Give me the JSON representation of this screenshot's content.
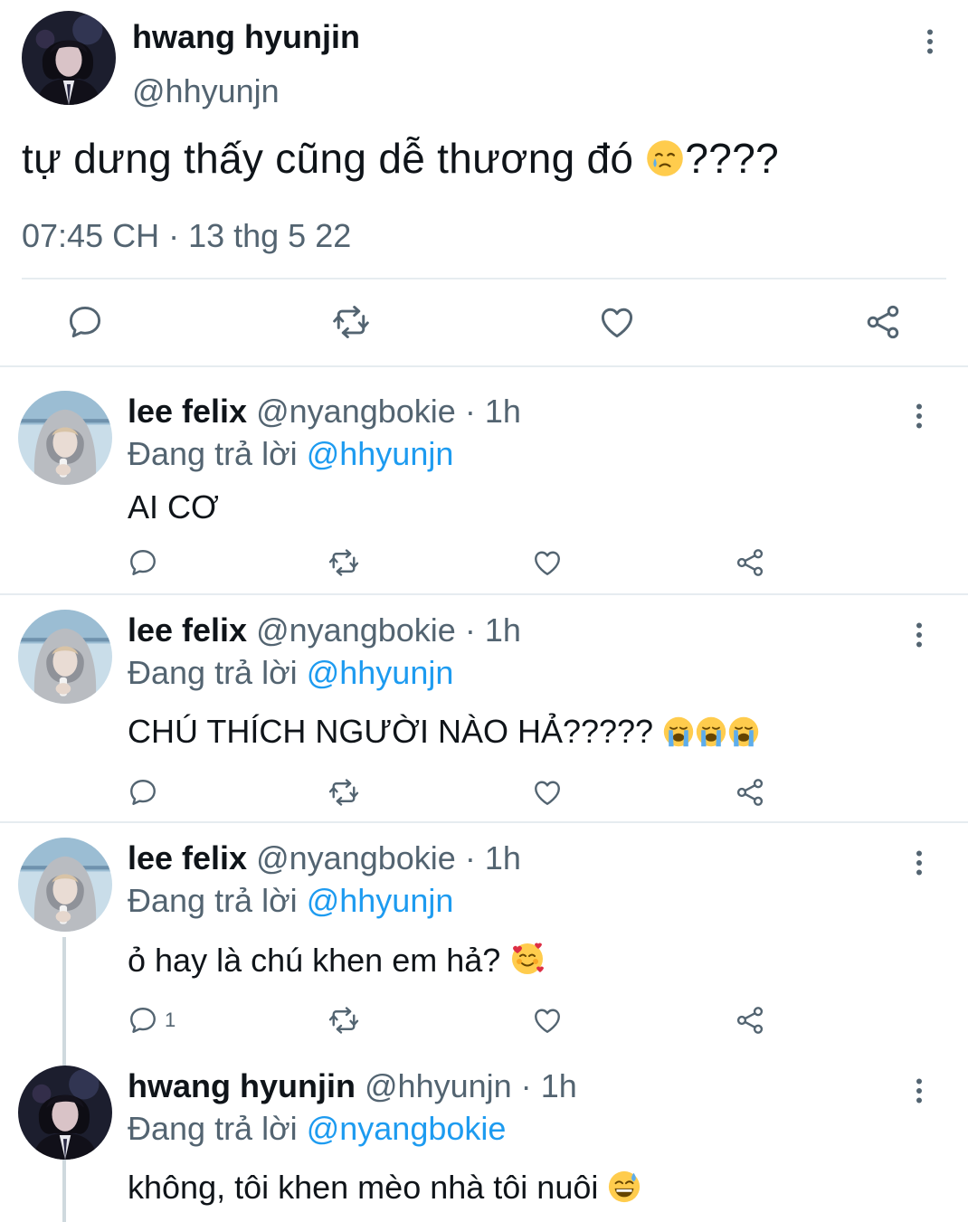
{
  "main_tweet": {
    "name": "hwang hyunjin",
    "handle": "@hhyunjn",
    "text": "tự dưng thấy cũng dễ thương đó",
    "text_suffix": "????",
    "text_emoji": "face-holding-back-tears",
    "meta": "07:45 CH · 13 thg 5 22",
    "actions": [
      "reply-icon",
      "retweet-icon",
      "like-icon",
      "share-icon"
    ]
  },
  "replies": [
    {
      "name": "lee felix",
      "handle": "@nyangbokie",
      "time": "1h",
      "replying_prefix": "Đang trả lời",
      "replying_to": "@hhyunjn",
      "text": "AI CƠ",
      "emojis": [],
      "reply_count": ""
    },
    {
      "name": "lee felix",
      "handle": "@nyangbokie",
      "time": "1h",
      "replying_prefix": "Đang trả lời",
      "replying_to": "@hhyunjn",
      "text": "CHÚ THÍCH NGƯỜI NÀO HẢ?????",
      "emojis": [
        "loudly-crying-face",
        "loudly-crying-face",
        "loudly-crying-face"
      ],
      "reply_count": ""
    },
    {
      "name": "lee felix",
      "handle": "@nyangbokie",
      "time": "1h",
      "replying_prefix": "Đang trả lời",
      "replying_to": "@hhyunjn",
      "text": "ỏ hay là chú khen em hả?",
      "emojis": [
        "smiling-face-with-hearts"
      ],
      "reply_count": "1"
    },
    {
      "name": "hwang hyunjin",
      "handle": "@hhyunjn",
      "time": "1h",
      "replying_prefix": "Đang trả lời",
      "replying_to": "@nyangbokie",
      "text": "không, tôi khen mèo nhà tôi nuôi",
      "emojis": [
        "grinning-face-with-sweat"
      ],
      "reply_count": ""
    }
  ],
  "dot": "·",
  "colors": {
    "text": "#0f1419",
    "secondary": "#536471",
    "link": "#1d9bf0",
    "divider": "#e6ecf0"
  }
}
